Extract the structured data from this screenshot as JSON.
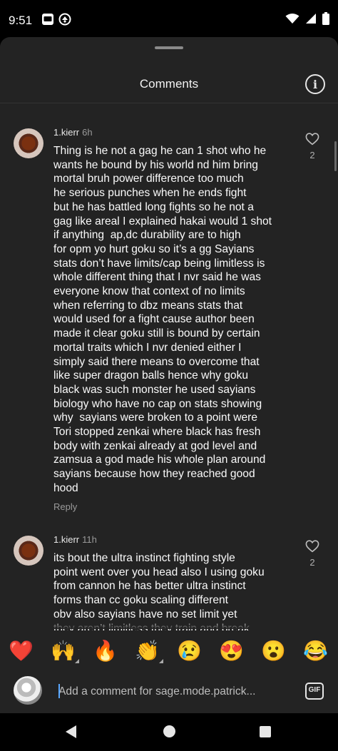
{
  "status_bar": {
    "time": "9:51"
  },
  "sheet": {
    "title": "Comments"
  },
  "comments": [
    {
      "username": "1.kierr",
      "time": "6h",
      "likes": "2",
      "reply_label": "Reply",
      "lines": [
        "Thing is he not a gag he can 1 shot who he",
        "wants he bound by his world nd him bring",
        "mortal bruh power difference too much",
        "he serious punches when he ends fight",
        "but he has battled long fights so he not a",
        "gag like areal I explained hakai would 1 shot",
        "if anything  ap,dc durability are to high",
        "for opm yo hurt goku so it’s a gg Sayians",
        "stats don’t have limits/cap being limitless is",
        "whole different thing that I nvr said he was",
        "everyone know that context of no limits",
        "when referring to dbz means stats that",
        "would used for a fight cause author been",
        "made it clear goku still is bound by certain",
        "mortal traits which I nvr denied either I",
        "simply said there means to overcome that",
        "like super dragon balls hence why goku",
        "black was such monster he used sayians",
        "biology who have no cap on stats showing",
        "why  sayians were broken to a point were",
        "Tori stopped zenkai where black has fresh",
        "body with zenkai already at god level and",
        "zamsua a god made his whole plan around",
        "sayians because how they reached good",
        "hood"
      ]
    },
    {
      "username": "1.kierr",
      "time": "11h",
      "likes": "2",
      "lines": [
        "its bout the ultra instinct fighting style",
        "point went over you head also I using goku",
        "from cannon he has better ultra instinct",
        "forms than cc goku scaling different",
        "obv also sayians have no set limit yet",
        "they aren’t limitless they train and break"
      ]
    }
  ],
  "emoji_bar": [
    {
      "name": "heart-emoji",
      "glyph": "❤️"
    },
    {
      "name": "raising-hands-emoji",
      "glyph": "🙌"
    },
    {
      "name": "fire-emoji",
      "glyph": "🔥"
    },
    {
      "name": "clapping-emoji",
      "glyph": "👏"
    },
    {
      "name": "crying-emoji",
      "glyph": "😢"
    },
    {
      "name": "heart-eyes-emoji",
      "glyph": "😍"
    },
    {
      "name": "surprised-emoji",
      "glyph": "😮"
    },
    {
      "name": "laughing-emoji",
      "glyph": "😂"
    }
  ],
  "composer": {
    "placeholder": "Add a comment for sage.mode.patrick...",
    "gif_label": "GIF"
  },
  "colors": {
    "background": "#232323",
    "text": "#fafafa",
    "secondary": "#9a9a9a"
  }
}
